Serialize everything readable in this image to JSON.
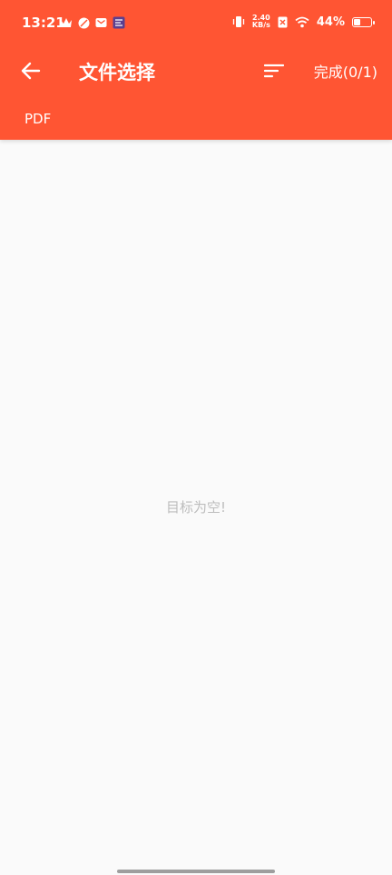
{
  "status_bar": {
    "time": "13:21",
    "net_speed_value": "2.40",
    "net_speed_unit": "KB/s",
    "battery_percent": "44%",
    "battery_level": 0.44,
    "icons": [
      "crown-icon",
      "rugby-ball-icon",
      "mail-icon",
      "app-icon",
      "vibrate-icon",
      "no-sim-icon",
      "wifi-icon",
      "battery-icon"
    ]
  },
  "toolbar": {
    "title": "文件选择",
    "done_label": "完成(0/1)",
    "icons": [
      "back-arrow-icon",
      "sort-icon"
    ]
  },
  "filter": {
    "tab_label": "PDF"
  },
  "content": {
    "empty_message": "目标为空!"
  },
  "colors": {
    "primary": "#ff5533",
    "background": "#fafafa",
    "empty_text": "#bdbdbd"
  }
}
